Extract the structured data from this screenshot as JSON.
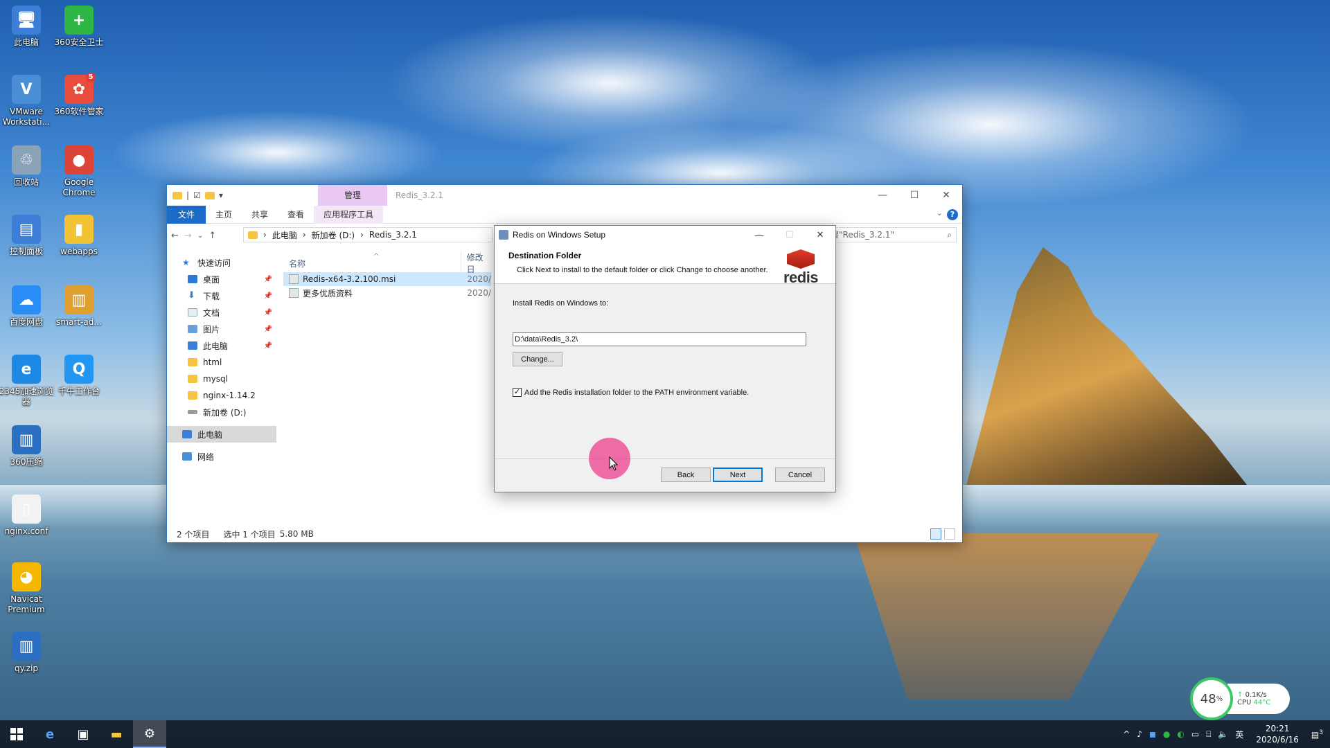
{
  "desktop": {
    "icons": [
      {
        "label": "此电脑",
        "glyph": "🖥",
        "color": "#3d7fd6"
      },
      {
        "label": "360安全卫士",
        "glyph": "+",
        "color": "#2fb544"
      },
      {
        "label": "VMware Workstati...",
        "glyph": "V",
        "color": "#4a8fd6"
      },
      {
        "label": "360软件管家",
        "glyph": "✿",
        "color": "#e84c3d"
      },
      {
        "label": "回收站",
        "glyph": "♲",
        "color": "#8aa3b8"
      },
      {
        "label": "Google Chrome",
        "glyph": "●",
        "color": "#db4437"
      },
      {
        "label": "控制面板",
        "glyph": "▤",
        "color": "#3d7fd6"
      },
      {
        "label": "webapps",
        "glyph": "▮",
        "color": "#f1c232"
      },
      {
        "label": "百度网盘",
        "glyph": "☁",
        "color": "#2a8cf5"
      },
      {
        "label": "smart-ad...",
        "glyph": "▥",
        "color": "#e0a030"
      },
      {
        "label": "2345加速浏览器",
        "glyph": "e",
        "color": "#1e88e5"
      },
      {
        "label": "千牛工作台",
        "glyph": "Q",
        "color": "#2196f3"
      },
      {
        "label": "360压缩",
        "glyph": "▥",
        "color": "#2b6fc2"
      },
      {
        "label": "nginx.conf",
        "glyph": "▯",
        "color": "#f2f2f2"
      },
      {
        "label": "Navicat Premium",
        "glyph": "◕",
        "color": "#f5b700"
      },
      {
        "label": "qy.zip",
        "glyph": "▥",
        "color": "#2b6fc2"
      }
    ],
    "badge_360soft": "5"
  },
  "explorer": {
    "title": "Redis_3.2.1",
    "manage_tab": "管理",
    "ribbon_tabs": [
      "文件",
      "主页",
      "共享",
      "查看",
      "应用程序工具"
    ],
    "breadcrumb": [
      "此电脑",
      "新加卷 (D:)",
      "Redis_3.2.1"
    ],
    "search_placeholder": "搜\"Redis_3.2.1\"",
    "nav": {
      "quick_access": "快速访问",
      "items": [
        "桌面",
        "下载",
        "文档",
        "图片",
        "此电脑",
        "html",
        "mysql",
        "nginx-1.14.2",
        "新加卷 (D:)"
      ],
      "this_pc": "此电脑",
      "network": "网络"
    },
    "columns": {
      "name": "名称",
      "date": "修改日"
    },
    "files": [
      {
        "name": "Redis-x64-3.2.100.msi",
        "date": "2020/"
      },
      {
        "name": "更多优质资料",
        "date": "2020/"
      }
    ],
    "status": {
      "count": "2 个项目",
      "selected": "选中 1 个项目",
      "size": "5.80 MB"
    }
  },
  "setup": {
    "title": "Redis on Windows Setup",
    "heading": "Destination Folder",
    "subheading": "Click Next to install to the default folder or click Change to choose another.",
    "logo_text": "redis",
    "install_label": "Install Redis on Windows to:",
    "install_path": "D:\\data\\Redis_3.2\\",
    "change_label": "Change...",
    "path_checkbox_label": "Add the Redis installation folder to the PATH environment variable.",
    "path_checked": true,
    "back_label": "Back",
    "next_label": "Next",
    "cancel_label": "Cancel"
  },
  "perf": {
    "percent": "48",
    "percent_unit": "%",
    "net_speed": "0.1K/s",
    "cpu_label": "CPU",
    "cpu_temp": "44°C"
  },
  "taskbar": {
    "ime": "英",
    "time": "20:21",
    "date": "2020/6/16",
    "notif_count": "3"
  }
}
